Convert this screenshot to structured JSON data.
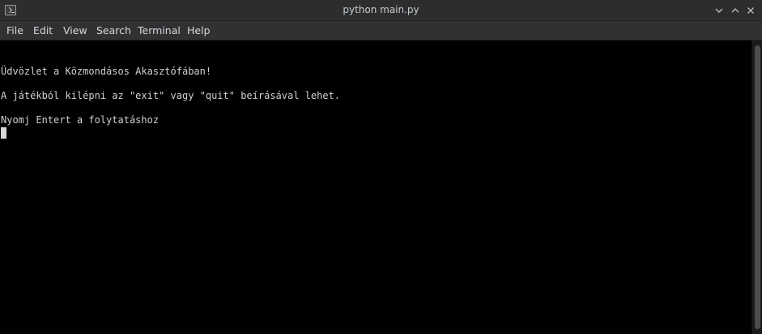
{
  "window": {
    "title": "python main.py",
    "icon": "terminal-icon",
    "controls": [
      "chevron-down-icon",
      "chevron-up-icon",
      "close-icon"
    ]
  },
  "menubar": {
    "items": [
      "File",
      "Edit",
      "View",
      "Search",
      "Terminal",
      "Help"
    ]
  },
  "terminal": {
    "lines": [
      "Üdvözlet a Közmondásos Akasztófában!",
      "A játékból kilépni az \"exit\" vagy \"quit\" beírásával lehet.",
      "Nyomj Entert a folytatáshoz"
    ],
    "background": "#000000",
    "foreground": "#d0d0d0"
  }
}
